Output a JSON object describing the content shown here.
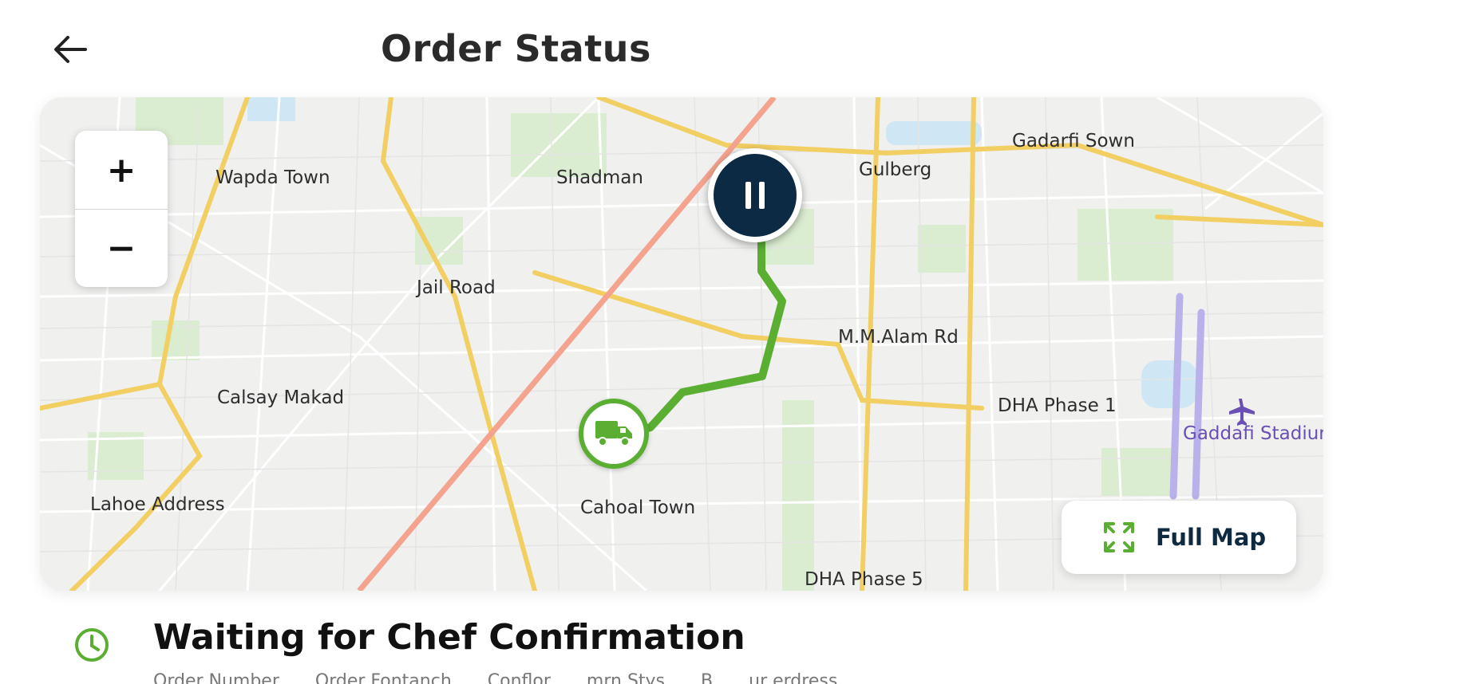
{
  "header": {
    "title": "Order Status",
    "back_icon": "arrow-left-icon"
  },
  "map": {
    "zoom_in_label": "+",
    "zoom_out_label": "−",
    "labels": {
      "wapda_town": "Wapda Town",
      "shadman": "Shadman",
      "gulberg": "Gulberg",
      "gadarfi_sown": "Gadarfi Sown",
      "jail_road": "Jail Road",
      "mm_alam_rd": "M.M.Alam Rd",
      "calsay_makad": "Calsay Makad",
      "dha_phase_1": "DHA Phase 1",
      "gaddafi_stadium": "Gaddafi Stadium",
      "lahore_address": "Lahoe Address",
      "cahoal_town": "Cahoal Town",
      "dha_phase_5": "DHA Phase 5"
    },
    "markers": {
      "chef_icon": "pause-icon",
      "delivery_icon": "truck-icon"
    },
    "route_color": "#5aae32",
    "full_map_label": "Full Map",
    "full_map_icon": "expand-icon"
  },
  "status": {
    "icon": "clock-icon",
    "title": "Waiting for Chef Confirmation",
    "meta": [
      "Order Number",
      "Order Fontanch",
      "Conflor",
      "mrn Stys",
      "B",
      "ur erdress"
    ]
  },
  "colors": {
    "accent_green": "#5aae32",
    "navy": "#0d2a44"
  }
}
